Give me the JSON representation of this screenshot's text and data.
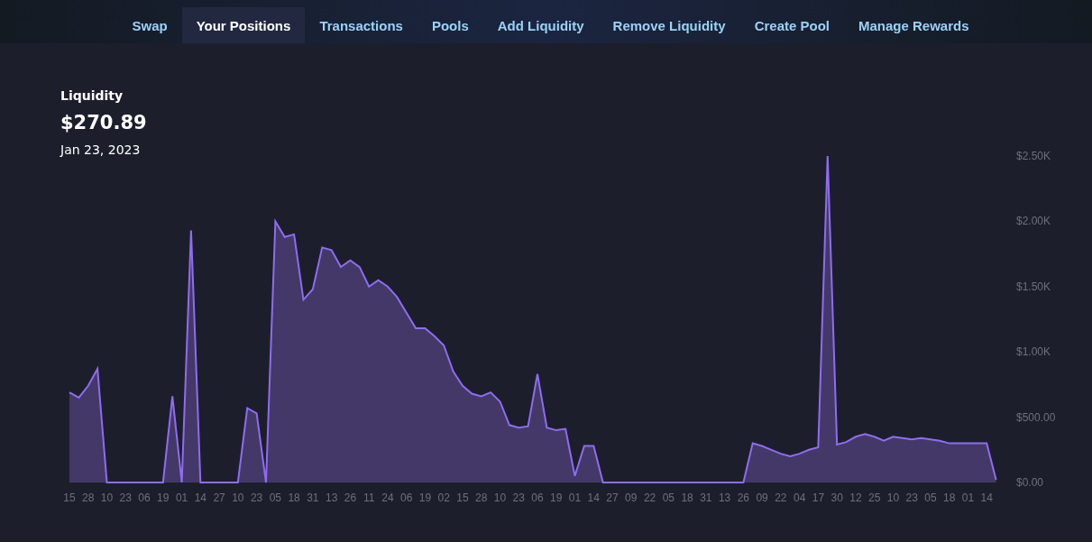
{
  "tabs": [
    {
      "label": "Swap",
      "selected": false
    },
    {
      "label": "Your Positions",
      "selected": true
    },
    {
      "label": "Transactions",
      "selected": false
    },
    {
      "label": "Pools",
      "selected": false
    },
    {
      "label": "Add Liquidity",
      "selected": false
    },
    {
      "label": "Remove Liquidity",
      "selected": false
    },
    {
      "label": "Create Pool",
      "selected": false
    },
    {
      "label": "Manage Rewards",
      "selected": false
    }
  ],
  "summary": {
    "value": "$270.89",
    "date": "Jan 23, 2023"
  },
  "chart_data": {
    "type": "area",
    "categories": [
      "15",
      null,
      "28",
      null,
      "10",
      null,
      "23",
      null,
      "06",
      null,
      "19",
      null,
      "01",
      null,
      "14",
      null,
      "27",
      null,
      "10",
      null,
      "23",
      null,
      "05",
      null,
      "18",
      null,
      "31",
      null,
      "13",
      null,
      "26",
      null,
      "11",
      null,
      "24",
      null,
      "06",
      null,
      "19",
      null,
      "02",
      null,
      "15",
      null,
      "28",
      null,
      "10",
      null,
      "23",
      null,
      "06",
      null,
      "19",
      null,
      "01",
      null,
      "14",
      null,
      "27",
      null,
      "09",
      null,
      "22",
      null,
      "05",
      null,
      "18",
      null,
      "31",
      null,
      "13",
      null,
      "26",
      null,
      "09",
      null,
      "22",
      null,
      "04",
      null,
      "17",
      null,
      "30",
      null,
      "12",
      null,
      "25",
      null,
      "10",
      null,
      "23",
      null,
      "05",
      null,
      "18",
      null,
      "01",
      null,
      "14",
      null
    ],
    "series": [
      {
        "name": "Liquidity",
        "color": "#8f6cf0",
        "values": [
          690,
          650,
          740,
          870,
          0,
          0,
          0,
          0,
          0,
          0,
          0,
          660,
          0,
          1930,
          0,
          0,
          0,
          0,
          0,
          570,
          530,
          0,
          2000,
          1880,
          1900,
          1400,
          1480,
          1800,
          1780,
          1650,
          1700,
          1650,
          1500,
          1550,
          1500,
          1420,
          1300,
          1180,
          1180,
          1120,
          1050,
          850,
          740,
          680,
          660,
          690,
          620,
          440,
          420,
          430,
          830,
          420,
          400,
          410,
          50,
          280,
          280,
          0,
          0,
          0,
          0,
          0,
          0,
          0,
          0,
          0,
          0,
          0,
          0,
          0,
          0,
          0,
          0,
          300,
          280,
          250,
          220,
          200,
          220,
          250,
          270,
          2500,
          290,
          310,
          350,
          370,
          350,
          320,
          350,
          340,
          330,
          340,
          330,
          320,
          300,
          300,
          300,
          300,
          300,
          20
        ]
      }
    ],
    "yticks": [
      {
        "value": 0,
        "label": "$0.00"
      },
      {
        "value": 500,
        "label": "$500.00"
      },
      {
        "value": 1000,
        "label": "$1.00K"
      },
      {
        "value": 1500,
        "label": "$1.50K"
      },
      {
        "value": 2000,
        "label": "$2.00K"
      },
      {
        "value": 2500,
        "label": "$2.50K"
      }
    ],
    "ylim": [
      0,
      2500
    ]
  }
}
